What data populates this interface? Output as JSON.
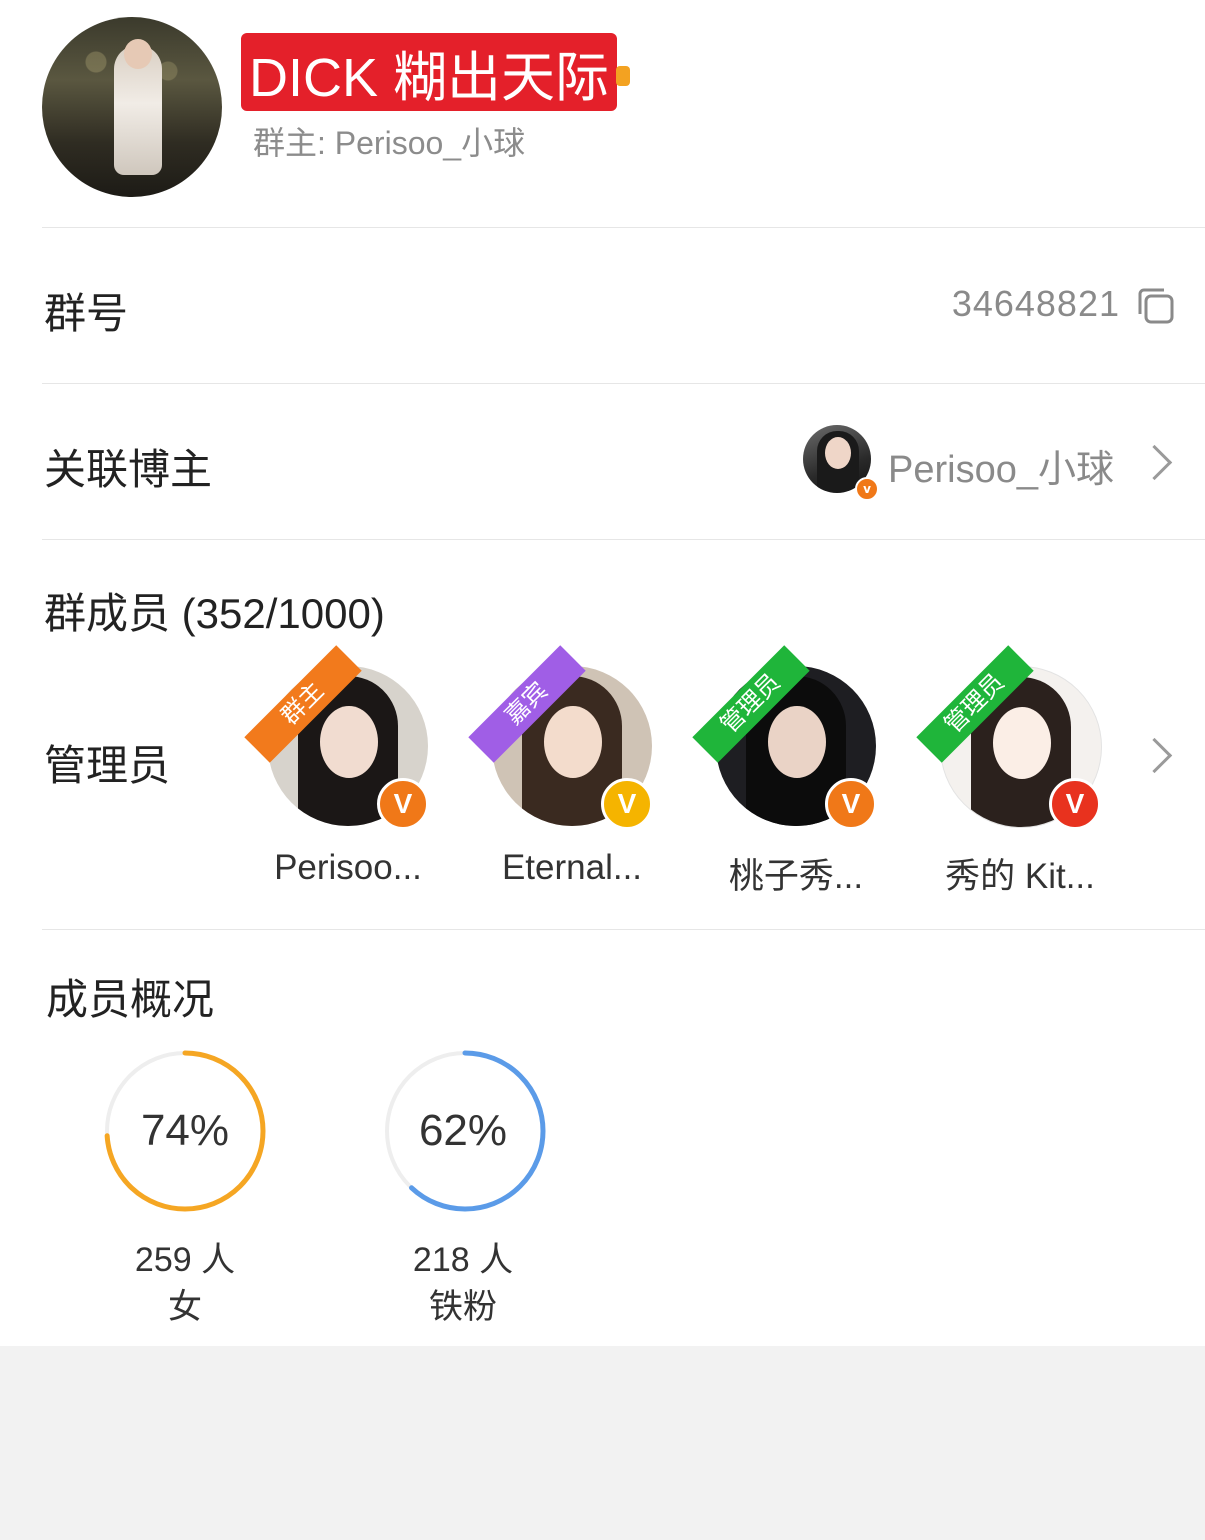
{
  "header": {
    "title": "DICK 糊出天际",
    "owner": "群主: Perisoo_小球"
  },
  "group_number": {
    "label": "群号",
    "value": "34648821"
  },
  "linked_blogger": {
    "label": "关联博主",
    "name": "Perisoo_小球"
  },
  "members": {
    "label": "群成员 (352/1000)"
  },
  "admins": {
    "label": "管理员",
    "items": [
      {
        "ribbon": "群主",
        "name": "Perisoo...",
        "ribbon_color": "#f27a1c",
        "v_color": "#f07818"
      },
      {
        "ribbon": "嘉宾",
        "name": "Eternal...",
        "ribbon_color": "#a05ee6",
        "v_color": "#f5b400"
      },
      {
        "ribbon": "管理员",
        "name": "桃子秀...",
        "ribbon_color": "#1fb53a",
        "v_color": "#f07818"
      },
      {
        "ribbon": "管理员",
        "name": "秀的 Kit...",
        "ribbon_color": "#1fb53a",
        "v_color": "#e8321e"
      }
    ]
  },
  "overview": {
    "label": "成员概况",
    "stats": [
      {
        "percent": "74%",
        "fraction": 0.74,
        "count": "259 人",
        "desc": "女",
        "color": "#f5a623"
      },
      {
        "percent": "62%",
        "fraction": 0.62,
        "count": "218 人",
        "desc": "铁粉",
        "color": "#5b9be8"
      }
    ]
  }
}
